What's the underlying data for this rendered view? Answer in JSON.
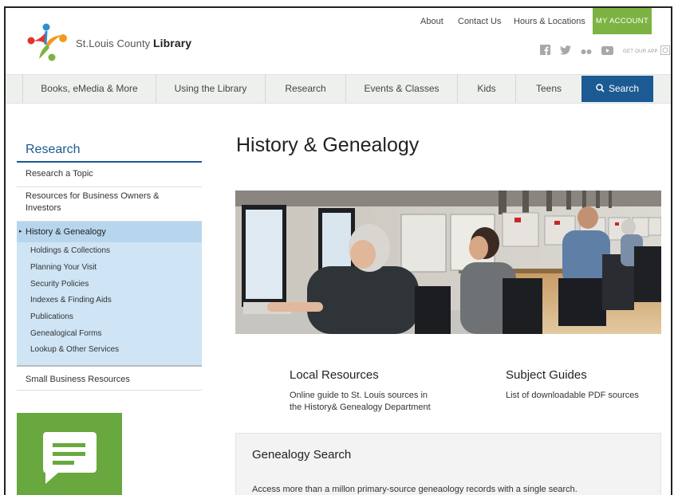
{
  "header": {
    "logo_text_plain": "St.Louis County ",
    "logo_text_bold": "Library",
    "top_links": [
      "About",
      "Contact Us",
      "Hours & Locations"
    ],
    "my_account": "MY ACCOUNT",
    "social_icons": [
      "facebook-icon",
      "twitter-icon",
      "flickr-icon",
      "youtube-icon"
    ],
    "get_app": "GET OUR APP"
  },
  "nav": {
    "items": [
      "Books, eMedia & More",
      "Using the Library",
      "Research",
      "Events & Classes",
      "Kids",
      "Teens"
    ],
    "search_label": "Search"
  },
  "sidebar": {
    "title": "Research",
    "items_top": [
      "Research a Topic",
      "Resources for Business Owners & Investors"
    ],
    "active": "History & Genealogy",
    "sub_items": [
      "Holdings & Collections",
      "Planning Your Visit",
      "Security Policies",
      "Indexes & Finding Aids",
      "Publications",
      "Genealogical Forms",
      "Lookup & Other Services"
    ],
    "items_bottom": [
      "Small Business Resources"
    ]
  },
  "main": {
    "title": "History & Genealogy",
    "columns": [
      {
        "title": "Local Resources",
        "desc_line1": "Online guide to St. Louis sources in",
        "desc_line2": "the History& Genealogy Department"
      },
      {
        "title": "Subject Guides",
        "desc_line1": "List of downloadable PDF sources",
        "desc_line2": ""
      }
    ],
    "genealogy": {
      "title": "Genealogy Search",
      "desc": "Access more than a millon primary-source geneaology records with a single search."
    }
  },
  "colors": {
    "brand_blue": "#1b5a92",
    "account_green": "#7cb342",
    "active_bg": "#cfe4f4",
    "chat_green": "#68a83e"
  }
}
